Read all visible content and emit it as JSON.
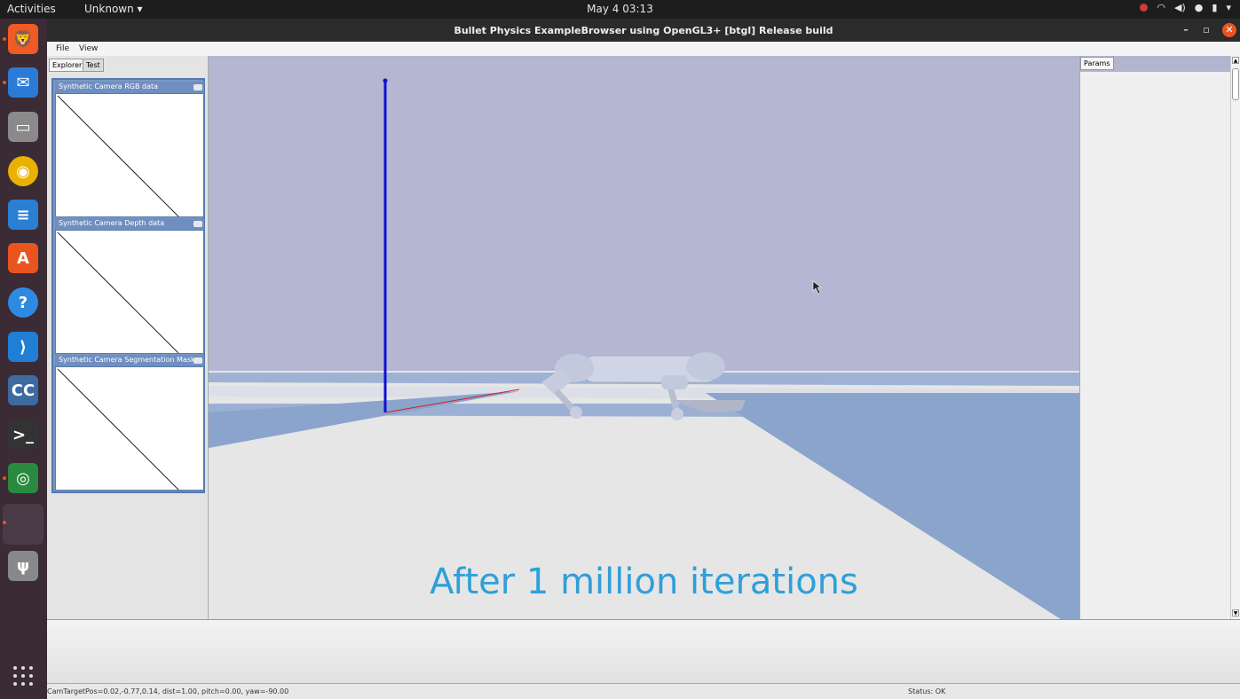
{
  "topbar": {
    "activities": "Activities",
    "app_menu": "Unknown",
    "clock": "May 4  03:13"
  },
  "dock": {
    "items": [
      {
        "name": "brave-browser-icon",
        "glyph": "🦁",
        "color": "#f05a24"
      },
      {
        "name": "thunderbird-icon",
        "glyph": "✉",
        "color": "#2b7bd6"
      },
      {
        "name": "files-icon",
        "glyph": "▭",
        "color": "#8a8a8a"
      },
      {
        "name": "rhythmbox-icon",
        "glyph": "◉",
        "color": "#e9b100"
      },
      {
        "name": "libreoffice-writer-icon",
        "glyph": "≡",
        "color": "#2a7fd4"
      },
      {
        "name": "software-center-icon",
        "glyph": "A",
        "color": "#e9541f"
      },
      {
        "name": "help-icon",
        "glyph": "?",
        "color": "#2d8ae0"
      },
      {
        "name": "vscode-icon",
        "glyph": "⟩",
        "color": "#1f7fd4"
      },
      {
        "name": "cc-app-icon",
        "glyph": "CC",
        "color": "#3d6aa0"
      },
      {
        "name": "terminal-icon",
        "glyph": ">_",
        "color": "#333333"
      },
      {
        "name": "camera-app-icon",
        "glyph": "◎",
        "color": "#2a8a40"
      },
      {
        "name": "active-window-icon",
        "glyph": "",
        "color": "#4a3a45"
      },
      {
        "name": "usb-drive-icon",
        "glyph": "ψ",
        "color": "#888888"
      }
    ]
  },
  "window": {
    "title": "Bullet Physics ExampleBrowser using OpenGL3+ [btgl] Release build"
  },
  "menu": {
    "file": "File",
    "view": "View"
  },
  "left_panel": {
    "tabs": [
      "Explorer",
      "Test"
    ],
    "cameras": [
      {
        "title": "Synthetic Camera RGB data"
      },
      {
        "title": "Synthetic Camera Depth data"
      },
      {
        "title": "Synthetic Camera Segmentation Mask"
      }
    ]
  },
  "right_panel": {
    "tab": "Params"
  },
  "viewport": {
    "caption": "After 1 million iterations",
    "sky_color": "#b4b6d2",
    "floor_color": "#e6e6e6",
    "shadow_color": "#8aa4cc",
    "robot_color": "#cfd4e6"
  },
  "status": {
    "camera": "CamTargetPos=0.02,-0.77,0.14, dist=1.00, pitch=0.00, yaw=-90.00",
    "state": "Status: OK"
  }
}
